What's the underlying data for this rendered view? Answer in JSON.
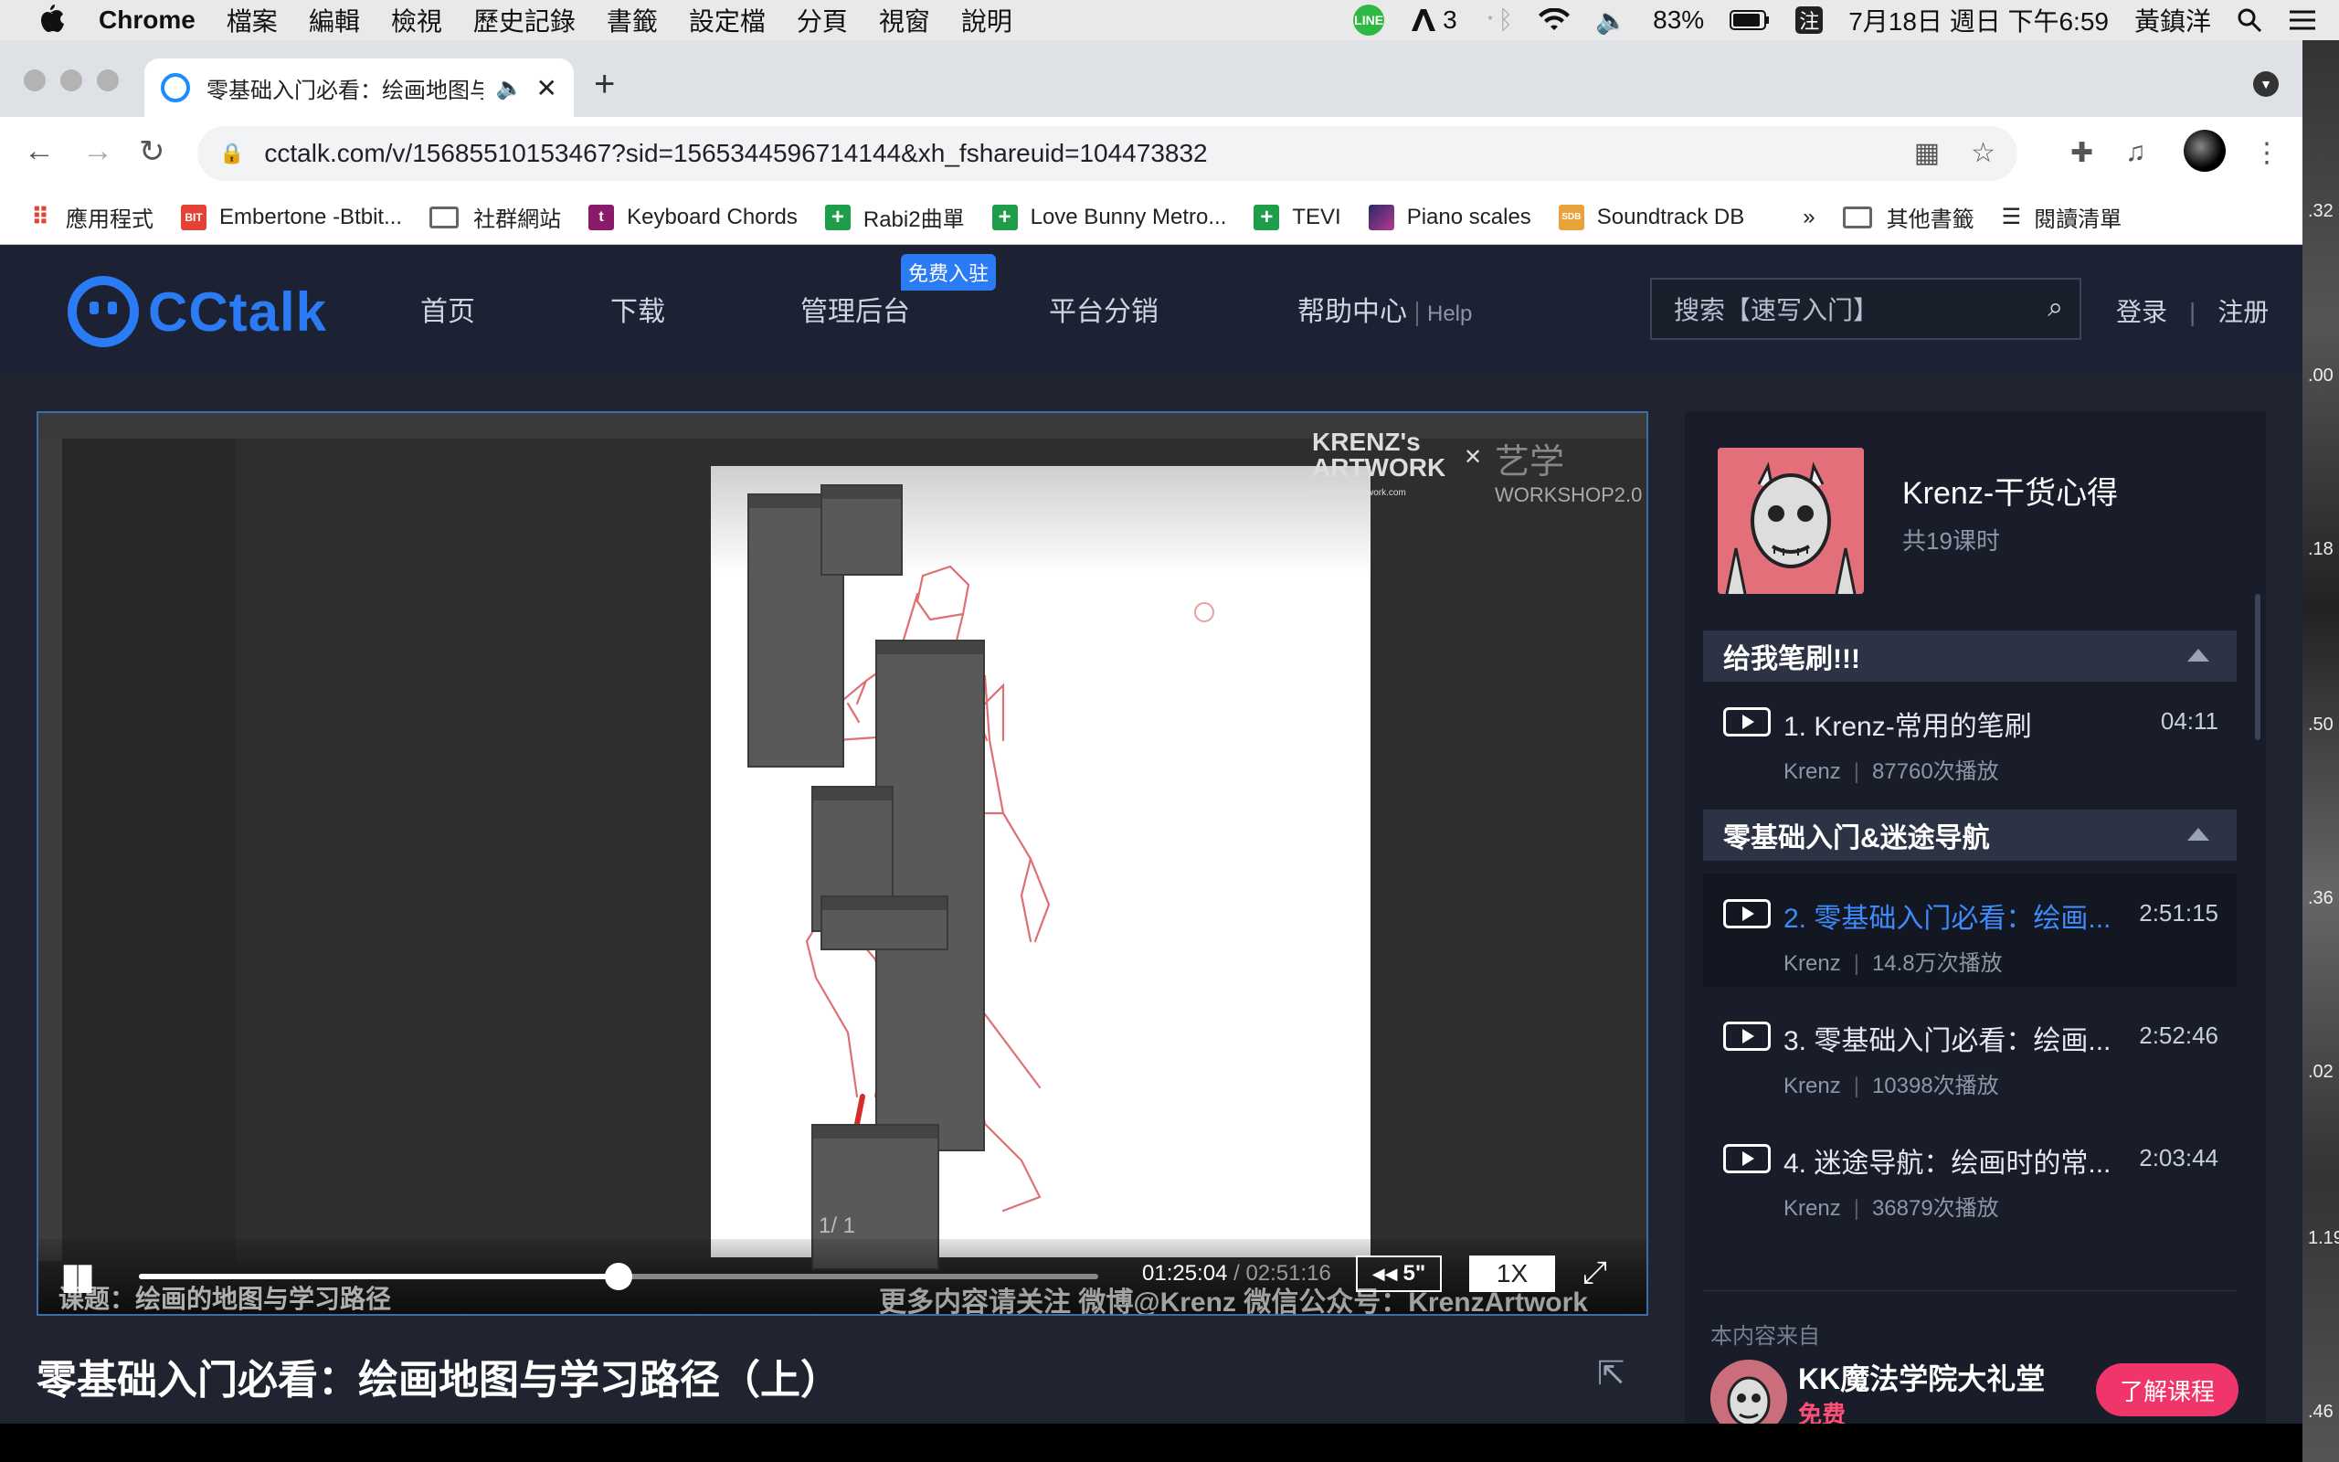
{
  "menubar": {
    "app": "Chrome",
    "items": [
      "檔案",
      "編輯",
      "檢視",
      "歷史記錄",
      "書籤",
      "設定檔",
      "分頁",
      "視窗",
      "說明"
    ],
    "line_badge": "LINE",
    "adobe_count": "3",
    "battery": "83%",
    "ime": "注",
    "datetime": "7月18日 週日 下午6:59",
    "user": "黃鎮洋"
  },
  "chrome": {
    "tab_title": "零基础入门必看：绘画地图与",
    "new_tab": "+",
    "url": "cctalk.com/v/15685510153467?sid=1565344596714144&xh_fshareuid=104473832",
    "bookmarks": [
      {
        "label": "應用程式",
        "icon": "apps-grid",
        "color": "#e34234"
      },
      {
        "label": "Embertone -Btbit...",
        "icon": "BIT",
        "color": "#e34234"
      },
      {
        "label": "社群網站",
        "icon": "folder"
      },
      {
        "label": "Keyboard Chords",
        "icon": "t",
        "color": "#8a1b6b"
      },
      {
        "label": "Rabi2曲單",
        "icon": "plus",
        "color": "#1e9e4a"
      },
      {
        "label": "Love Bunny Metro...",
        "icon": "plus",
        "color": "#1e9e4a"
      },
      {
        "label": "TEVI",
        "icon": "plus",
        "color": "#1e9e4a"
      },
      {
        "label": "Piano scales",
        "icon": "square",
        "color": "#5b2a86"
      },
      {
        "label": "Soundtrack DB",
        "icon": "SDB",
        "color": "#e8a33a"
      }
    ],
    "bookmarks_more": "»",
    "other_bookmarks": "其他書籤",
    "reading_list": "閱讀清單"
  },
  "edge_numbers": [
    ".32",
    ".00",
    ".18",
    ".50",
    ".36",
    ".02",
    "1.19",
    ".46"
  ],
  "site": {
    "logo": "CCtalk",
    "nav": [
      "首页",
      "下载",
      "管理后台",
      "平台分销",
      "帮助中心"
    ],
    "help_sub": "Help",
    "free_badge": "免费入驻",
    "search_placeholder": "搜索【速写入门】",
    "login": "登录",
    "register": "注册"
  },
  "video": {
    "brand": "KRENZ's",
    "brand2": "ARTWORK",
    "brand_url": "www.krenzartwork.com",
    "workshop": "艺学",
    "workshop2": "WORKSHOP2.0",
    "page_indicator": "1/ 1",
    "current_time": "01:25:04",
    "total_time": "02:51:16",
    "rewind": "5\"",
    "speed": "1X",
    "progress": 0.5,
    "course_subtitle": "课题：绘画的地图与学习路径",
    "more_info": "更多内容请关注 微博@Krenz 微信公众号：KrenzArtwork"
  },
  "video_title": "零基础入门必看：绘画地图与学习路径（上）",
  "sidebar": {
    "course_name": "Krenz-干货心得",
    "course_count": "共19课时",
    "sections": [
      {
        "title": "给我笔刷!!!",
        "lessons": [
          {
            "title": "1. Krenz-常用的笔刷",
            "duration": "04:11",
            "author": "Krenz",
            "plays": "87760次播放"
          }
        ]
      },
      {
        "title": "零基础入门&迷途导航",
        "lessons": [
          {
            "title": "2. 零基础入门必看：绘画...",
            "duration": "2:51:15",
            "author": "Krenz",
            "plays": "14.8万次播放"
          },
          {
            "title": "3. 零基础入门必看：绘画...",
            "duration": "2:52:46",
            "author": "Krenz",
            "plays": "10398次播放"
          },
          {
            "title": "4. 迷途导航：绘画时的常...",
            "duration": "2:03:44",
            "author": "Krenz",
            "plays": "36879次播放"
          }
        ]
      }
    ],
    "from_label": "本内容来自",
    "org_name": "KK魔法学院大礼堂",
    "org_free": "免费",
    "learn_button": "了解课程"
  }
}
